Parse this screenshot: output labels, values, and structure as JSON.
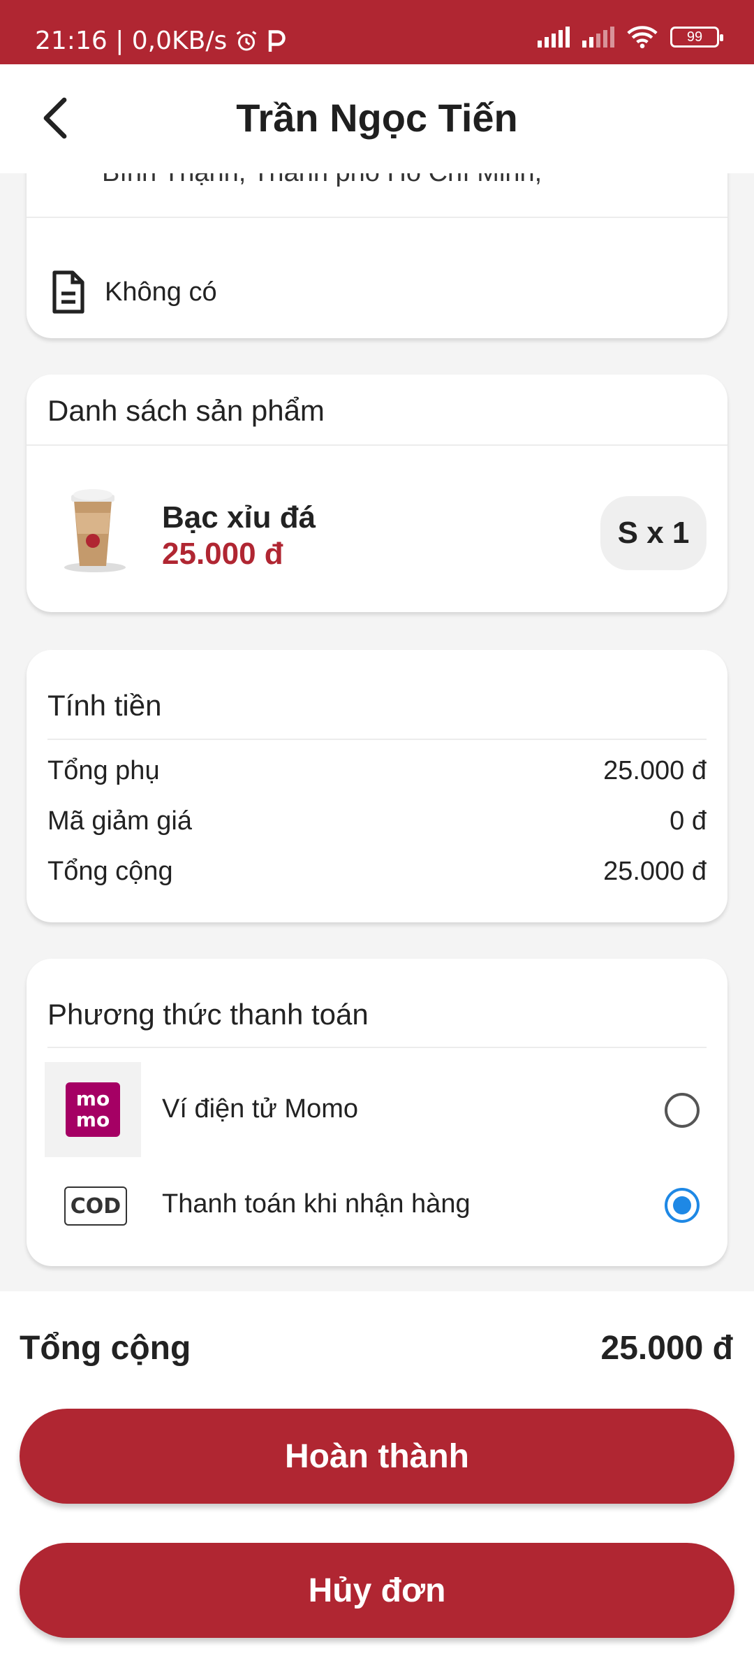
{
  "status_bar": {
    "time_speed": "21:16 | 0,0KB/s",
    "battery": "99"
  },
  "header": {
    "title": "Trần Ngọc Tiến"
  },
  "info": {
    "address_partial": "Bình Thạnh, Thành phố Hồ Chí Minh,",
    "note": "Không có"
  },
  "products": {
    "heading": "Danh sách sản phẩm",
    "items": [
      {
        "name": "Bạc xỉu đá",
        "price": "25.000 đ",
        "qty": "S x 1"
      }
    ]
  },
  "bill": {
    "heading": "Tính tiền",
    "rows": [
      {
        "label": "Tổng phụ",
        "value": "25.000 đ"
      },
      {
        "label": "Mã giảm giá",
        "value": "0 đ"
      },
      {
        "label": "Tổng cộng",
        "value": "25.000 đ"
      }
    ]
  },
  "payment": {
    "heading": "Phương thức thanh toán",
    "methods": [
      {
        "label": "Ví điện tử Momo",
        "logo_text": "mo mo",
        "selected": false
      },
      {
        "label": "Thanh toán khi nhận hàng",
        "logo_text": "COD",
        "selected": true
      }
    ]
  },
  "footer": {
    "total_label": "Tổng cộng",
    "total_value": "25.000 đ",
    "complete_label": "Hoàn thành",
    "cancel_label": "Hủy đơn"
  },
  "colors": {
    "brand": "#b02632",
    "radio_selected": "#1e88e5",
    "momo": "#a50064"
  }
}
